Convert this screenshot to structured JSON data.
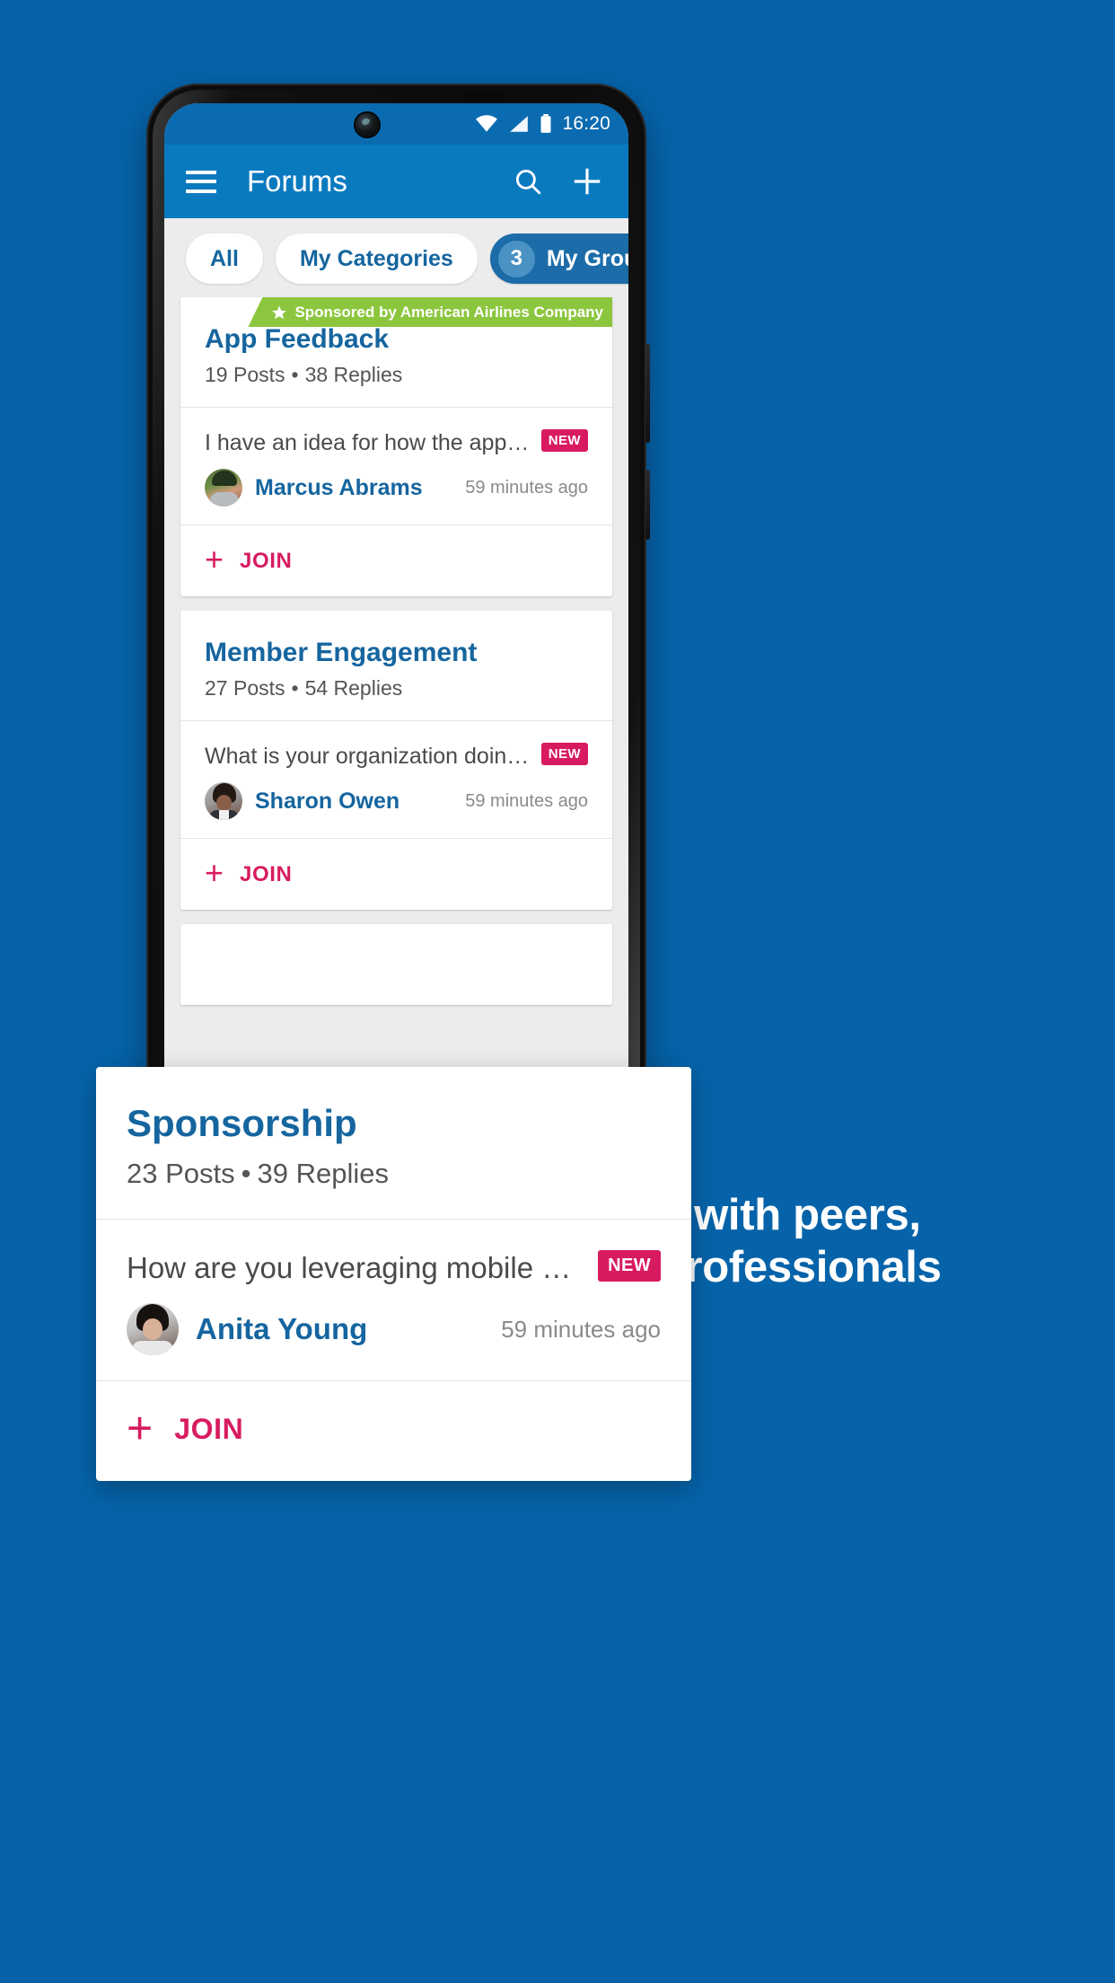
{
  "theme": {
    "page_bg": "#0663a9",
    "appbar_bg": "#0a7abf",
    "statusbar_bg": "#0a6bb0",
    "accent_pink": "#d81b60",
    "link_blue": "#15659f",
    "sponsor_green": "#8cc63e"
  },
  "status_bar": {
    "time": "16:20",
    "icons": [
      "wifi-icon",
      "signal-icon",
      "battery-icon"
    ],
    "camera": "front-camera-punch-hole"
  },
  "app_bar": {
    "menu_icon": "hamburger-menu-icon",
    "title": "Forums",
    "search_icon": "search-icon",
    "add_icon": "plus-icon"
  },
  "filters": {
    "chips": [
      {
        "label": "All",
        "active": false
      },
      {
        "label": "My Categories",
        "active": false
      },
      {
        "label": "My Groups",
        "active": true,
        "count": "3",
        "close_icon": "close-circle-icon"
      }
    ]
  },
  "feed": {
    "cards": [
      {
        "sponsor": {
          "star_icon": "star-icon",
          "text": "Sponsored by American Airlines Company"
        },
        "title": "App Feedback",
        "posts": "19 Posts",
        "separator": "•",
        "replies": "38 Replies",
        "thread": {
          "text": "I have an idea for how the app can make a…",
          "badge": "NEW",
          "author": "Marcus Abrams",
          "time": "59 minutes ago"
        },
        "join": {
          "icon": "plus-icon",
          "label": "JOIN"
        }
      },
      {
        "title": "Member Engagement",
        "posts": "27 Posts",
        "separator": "•",
        "replies": "54 Replies",
        "thread": {
          "text": "What is your organization doing to attract…",
          "badge": "NEW",
          "author": "Sharon Owen",
          "time": "59 minutes ago"
        },
        "join": {
          "icon": "plus-icon",
          "label": "JOIN"
        }
      }
    ]
  },
  "overlay_card": {
    "title": "Sponsorship",
    "posts": "23 Posts",
    "separator": "•",
    "replies": "39 Replies",
    "thread": {
      "text": "How are you leveraging mobile with your s…",
      "badge": "NEW",
      "author": "Anita Young",
      "time": "59 minutes ago"
    },
    "join": {
      "icon": "plus-icon",
      "label": "JOIN"
    }
  },
  "caption": {
    "line1": "Share and source ideas with peers,",
    "line2": "colleagues and trusted professionals"
  }
}
